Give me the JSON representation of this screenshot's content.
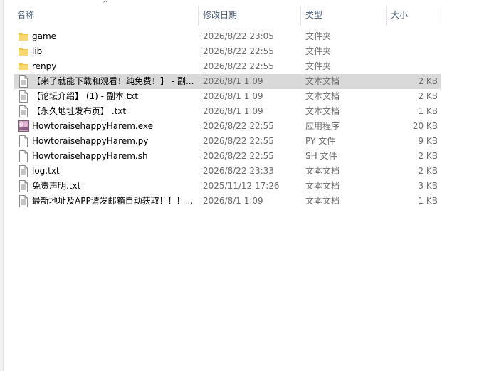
{
  "header": {
    "name_label": "名称",
    "date_label": "修改日期",
    "type_label": "类型",
    "size_label": "大小",
    "sort_glyph": "^"
  },
  "colors": {
    "folder": "#f4c542",
    "selection": "#d9d9d9",
    "header_text": "#4c607a",
    "secondary_text": "#6d6d6d"
  },
  "files": [
    {
      "name": "game",
      "date": "2026/8/22 23:05",
      "type": "文件夹",
      "size": "",
      "icon": "folder-icon"
    },
    {
      "name": "lib",
      "date": "2026/8/22 22:55",
      "type": "文件夹",
      "size": "",
      "icon": "folder-icon"
    },
    {
      "name": "renpy",
      "date": "2026/8/22 22:55",
      "type": "文件夹",
      "size": "",
      "icon": "folder-icon"
    },
    {
      "name": "【来了就能下载和观看！纯免费！】 - 副...",
      "date": "2026/8/1 1:09",
      "type": "文本文档",
      "size": "2 KB",
      "icon": "text-document-icon",
      "selected": true
    },
    {
      "name": "【论坛介绍】 (1) - 副本.txt",
      "date": "2026/8/1 1:09",
      "type": "文本文档",
      "size": "2 KB",
      "icon": "text-document-icon"
    },
    {
      "name": "【永久地址发布页】 .txt",
      "date": "2026/8/1 1:09",
      "type": "文本文档",
      "size": "1 KB",
      "icon": "text-document-icon"
    },
    {
      "name": "HowtoraisehappyHarem.exe",
      "date": "2026/8/22 22:55",
      "type": "应用程序",
      "size": "20 KB",
      "icon": "application-icon"
    },
    {
      "name": "HowtoraisehappyHarem.py",
      "date": "2026/8/22 22:55",
      "type": "PY 文件",
      "size": "9 KB",
      "icon": "blank-file-icon"
    },
    {
      "name": "HowtoraisehappyHarem.sh",
      "date": "2026/8/22 22:55",
      "type": "SH 文件",
      "size": "2 KB",
      "icon": "blank-file-icon"
    },
    {
      "name": "log.txt",
      "date": "2026/8/22 23:33",
      "type": "文本文档",
      "size": "2 KB",
      "icon": "text-document-icon"
    },
    {
      "name": "免责声明.txt",
      "date": "2025/11/12 17:26",
      "type": "文本文档",
      "size": "3 KB",
      "icon": "text-document-icon"
    },
    {
      "name": "最新地址及APP请发邮箱自动获取！！！...",
      "date": "2026/8/1 1:09",
      "type": "文本文档",
      "size": "1 KB",
      "icon": "text-document-icon"
    }
  ]
}
